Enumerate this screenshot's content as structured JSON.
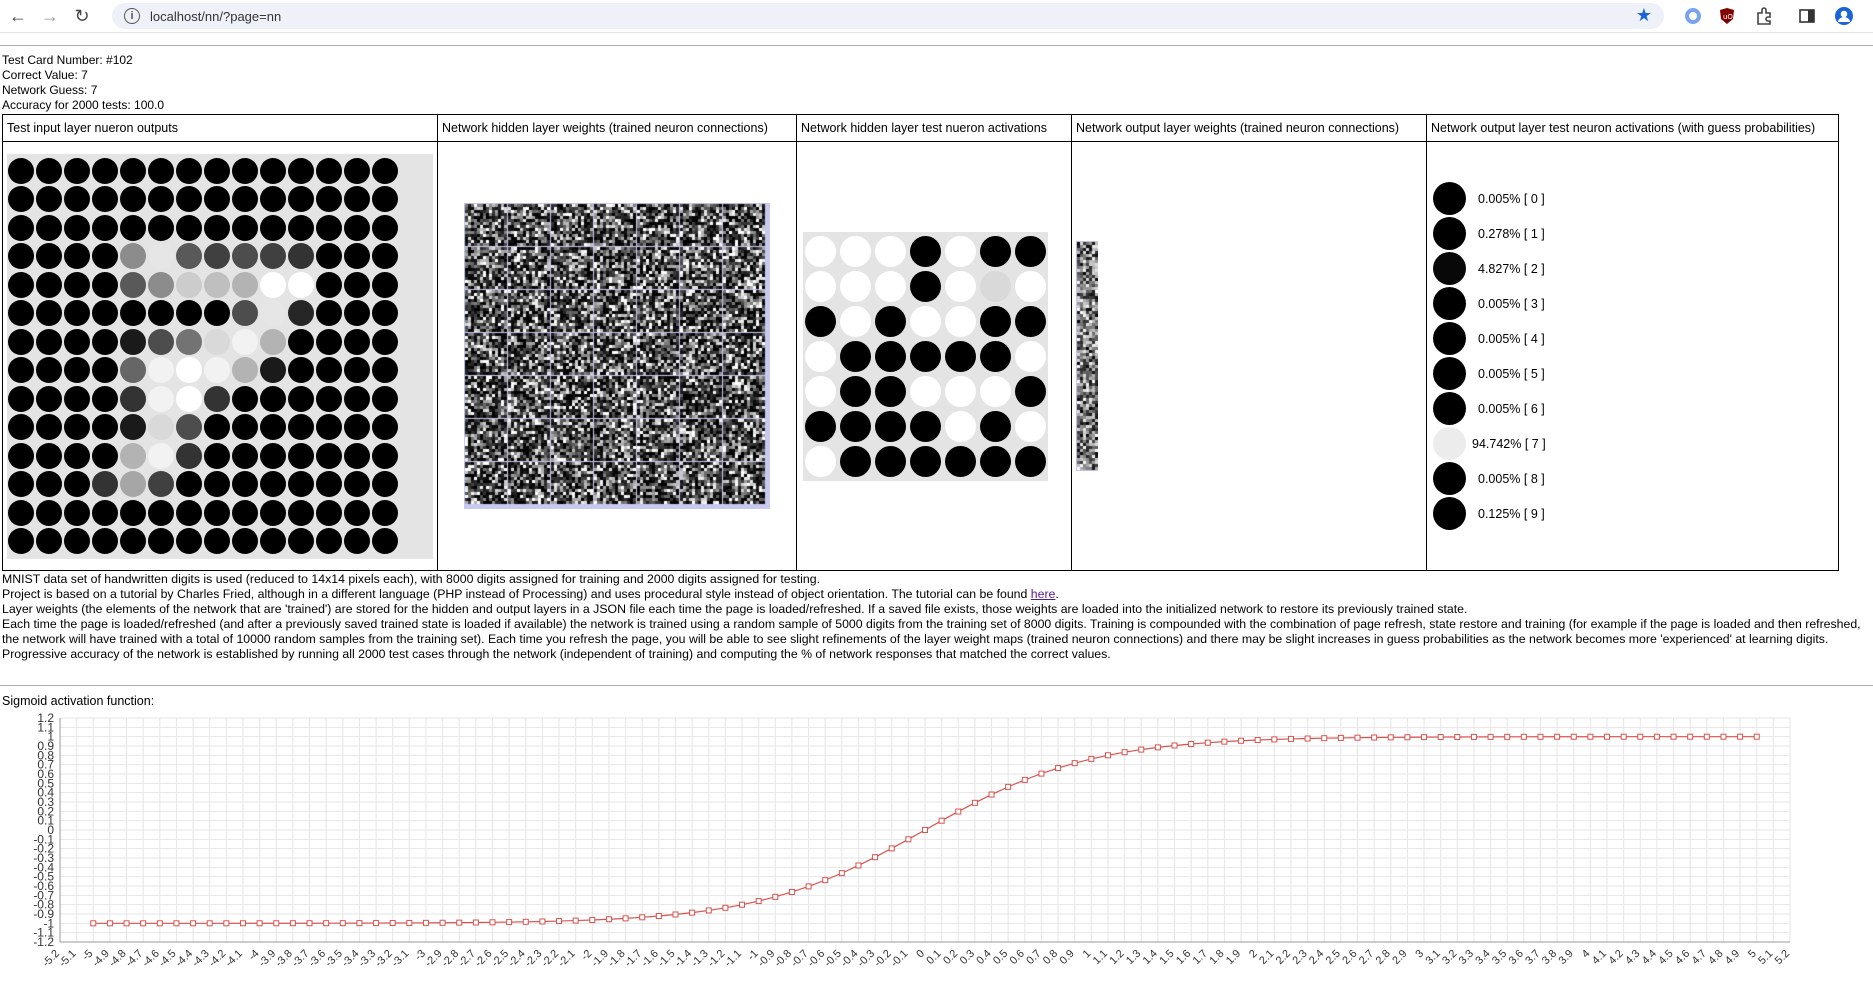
{
  "browser": {
    "url": "localhost/nn/?page=nn",
    "back_icon": "arrow-left-icon",
    "forward_icon": "arrow-right-icon",
    "reload_icon": "reload-icon"
  },
  "info": {
    "card_number": "Test Card Number: #102",
    "correct_value": "Correct Value: 7",
    "network_guess": "Network Guess: 7",
    "accuracy": "Accuracy for 2000 tests: 100.0"
  },
  "table": {
    "headers": [
      "Test input layer nueron outputs",
      "Network hidden layer weights (trained neuron connections)",
      "Network hidden layer test nueron activations",
      "Network output layer weights (trained neuron connections)",
      "Network output layer test neuron activations (with guess probabilities)"
    ],
    "input_grid": [
      [
        0,
        0,
        0,
        0,
        0,
        0,
        0,
        0,
        0,
        0,
        0,
        0,
        0,
        0
      ],
      [
        0,
        0,
        0,
        0,
        0,
        0,
        0,
        0,
        0,
        0,
        0,
        0,
        0,
        0
      ],
      [
        0,
        0,
        0,
        0,
        0,
        0,
        0,
        0,
        0,
        0,
        0,
        0,
        0,
        0
      ],
      [
        0,
        0,
        0,
        0,
        0.55,
        0.9,
        0.35,
        0.25,
        0.3,
        0.25,
        0.2,
        0,
        0,
        0
      ],
      [
        0,
        0,
        0,
        0,
        0.35,
        0.55,
        0.8,
        0.75,
        0.7,
        1,
        1,
        0,
        0,
        0
      ],
      [
        0,
        0,
        0,
        0,
        0,
        0,
        0,
        0,
        0.3,
        0.9,
        0.15,
        0,
        0,
        0
      ],
      [
        0,
        0,
        0,
        0,
        0.1,
        0.3,
        0.45,
        0.85,
        0.95,
        0.7,
        0,
        0,
        0,
        0
      ],
      [
        0,
        0,
        0,
        0,
        0.4,
        0.95,
        1,
        0.95,
        0.7,
        0.1,
        0,
        0,
        0,
        0
      ],
      [
        0,
        0,
        0,
        0,
        0.2,
        0.95,
        1,
        0.2,
        0,
        0,
        0,
        0,
        0,
        0
      ],
      [
        0,
        0,
        0,
        0,
        0.1,
        0.85,
        0.3,
        0,
        0,
        0,
        0,
        0,
        0,
        0
      ],
      [
        0,
        0,
        0,
        0,
        0.7,
        0.95,
        0.2,
        0,
        0,
        0,
        0,
        0,
        0,
        0
      ],
      [
        0,
        0,
        0,
        0.2,
        0.65,
        0.25,
        0,
        0,
        0,
        0,
        0,
        0,
        0,
        0
      ],
      [
        0,
        0,
        0,
        0,
        0,
        0,
        0,
        0,
        0,
        0,
        0,
        0,
        0,
        0
      ],
      [
        0,
        0,
        0,
        0,
        0,
        0,
        0,
        0,
        0,
        0,
        0,
        0,
        0,
        0
      ]
    ],
    "hidden_activations": [
      [
        1,
        1,
        1,
        0,
        1,
        0,
        0
      ],
      [
        1,
        1,
        1,
        0,
        1,
        0.85,
        1
      ],
      [
        0,
        1,
        0,
        1,
        1,
        0,
        0
      ],
      [
        1,
        0,
        0,
        0,
        0,
        0,
        1
      ],
      [
        1,
        0,
        0,
        1,
        1,
        1,
        0
      ],
      [
        0,
        0,
        0,
        0,
        1,
        0,
        1
      ],
      [
        1,
        0,
        0,
        0,
        0,
        0,
        0
      ]
    ],
    "outputs": [
      {
        "value": 0,
        "label": "0.005% [ 0 ]"
      },
      {
        "value": 0,
        "label": "0.278% [ 1 ]"
      },
      {
        "value": 0.05,
        "label": "4.827% [ 2 ]"
      },
      {
        "value": 0,
        "label": "0.005% [ 3 ]"
      },
      {
        "value": 0,
        "label": "0.005% [ 4 ]"
      },
      {
        "value": 0,
        "label": "0.005% [ 5 ]"
      },
      {
        "value": 0,
        "label": "0.005% [ 6 ]"
      },
      {
        "value": 0.947,
        "label": "94.742% [ 7 ]"
      },
      {
        "value": 0,
        "label": "0.005% [ 8 ]"
      },
      {
        "value": 0,
        "label": "0.125% [ 9 ]"
      }
    ]
  },
  "description": {
    "line1": "MNIST data set of handwritten digits is used (reduced to 14x14 pixels each), with 8000 digits assigned for training and 2000 digits assigned for testing.",
    "line2_before": "Project is based on a tutorial by Charles Fried, although in a different language (PHP instead of Processing) and uses procedural style instead of object orientation. The tutorial can be found ",
    "line2_link": "here",
    "line2_after": ".",
    "line3": "Layer weights (the elements of the network that are 'trained') are stored for the hidden and output layers in a JSON file each time the page is loaded/refreshed. If a saved file exists, those weights are loaded into the initialized network to restore its previously trained state.",
    "line4": "Each time the page is loaded/refreshed (and after a previously saved trained state is loaded if available) the network is trained using a random sample of 5000 digits from the training set of 8000 digits. Training is compounded with the combination of page refresh, state restore and training (for example if the page is loaded and then refreshed, the network will have trained with a total of 10000 random samples from the training set). Each time you refresh the page, you will be able to see slight refinements of the layer weight maps (trained neuron connections) and there may be slight increases in guess probabilities as the network becomes more 'experienced' at learning digits.",
    "line5": "Progressive accuracy of the network is established by running all 2000 test cases through the network (independent of training) and computing the % of network responses that matched the correct values."
  },
  "sigmoid_title": "Sigmoid activation function:",
  "chart_data": {
    "type": "line",
    "title": "",
    "xlabel": "",
    "ylabel": "",
    "function": "tanh",
    "x_start": -5,
    "x_end": 5,
    "x_step": 0.1,
    "xlim": [
      -5.2,
      5.2
    ],
    "ylim": [
      -1.2,
      1.2
    ],
    "y_ticks": [
      "1.2",
      "1.1",
      "1",
      "0.9",
      "0.8",
      "0.7",
      "0.6",
      "0.5",
      "0.4",
      "0.3",
      "0.2",
      "0.1",
      "0",
      "-0.1",
      "-0.2",
      "-0.3",
      "-0.4",
      "-0.5",
      "-0.6",
      "-0.7",
      "-0.8",
      "-0.9",
      "-1",
      "-1.1",
      "-1.2"
    ],
    "line_color": "#d9534f",
    "grid": true
  }
}
